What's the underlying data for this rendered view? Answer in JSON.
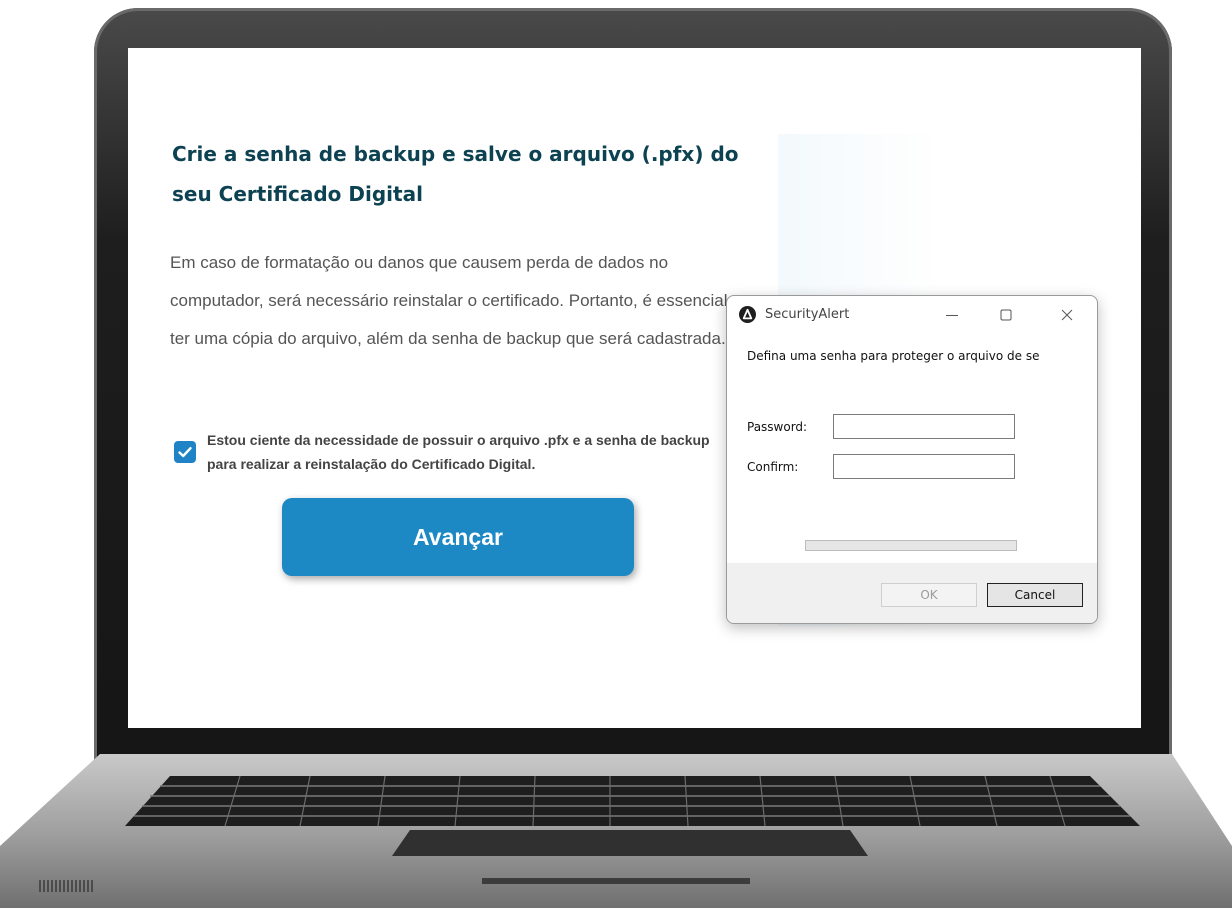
{
  "page": {
    "title": "Crie a senha de backup e salve o arquivo (.pfx) do seu Certificado Digital",
    "description": "Em caso de formatação ou danos que causem perda de dados no computador, será necessário reinstalar o certificado. Portanto, é essencial ter uma cópia do arquivo, além da senha de backup que será cadastrada.",
    "consent_checked": true,
    "consent_text": "Estou ciente da necessidade de possuir o arquivo .pfx e a senha de backup para realizar a reinstalação do Certificado Digital.",
    "advance_button": "Avançar"
  },
  "dialog": {
    "title": "SecurityAlert",
    "message": "Defina uma senha para proteger o arquivo de se",
    "password_label": "Password:",
    "password_value": "",
    "confirm_label": "Confirm:",
    "confirm_value": "",
    "progress_value": 0,
    "ok_label": "OK",
    "cancel_label": "Cancel",
    "ok_enabled": false
  },
  "icons": {
    "app": "app-logo-icon",
    "minimize": "minimize-icon",
    "maximize": "maximize-icon",
    "close": "close-icon",
    "checkbox": "checkmark-icon"
  },
  "colors": {
    "accent": "#1c88c4",
    "heading": "#0d4252",
    "body_text": "#555555"
  }
}
